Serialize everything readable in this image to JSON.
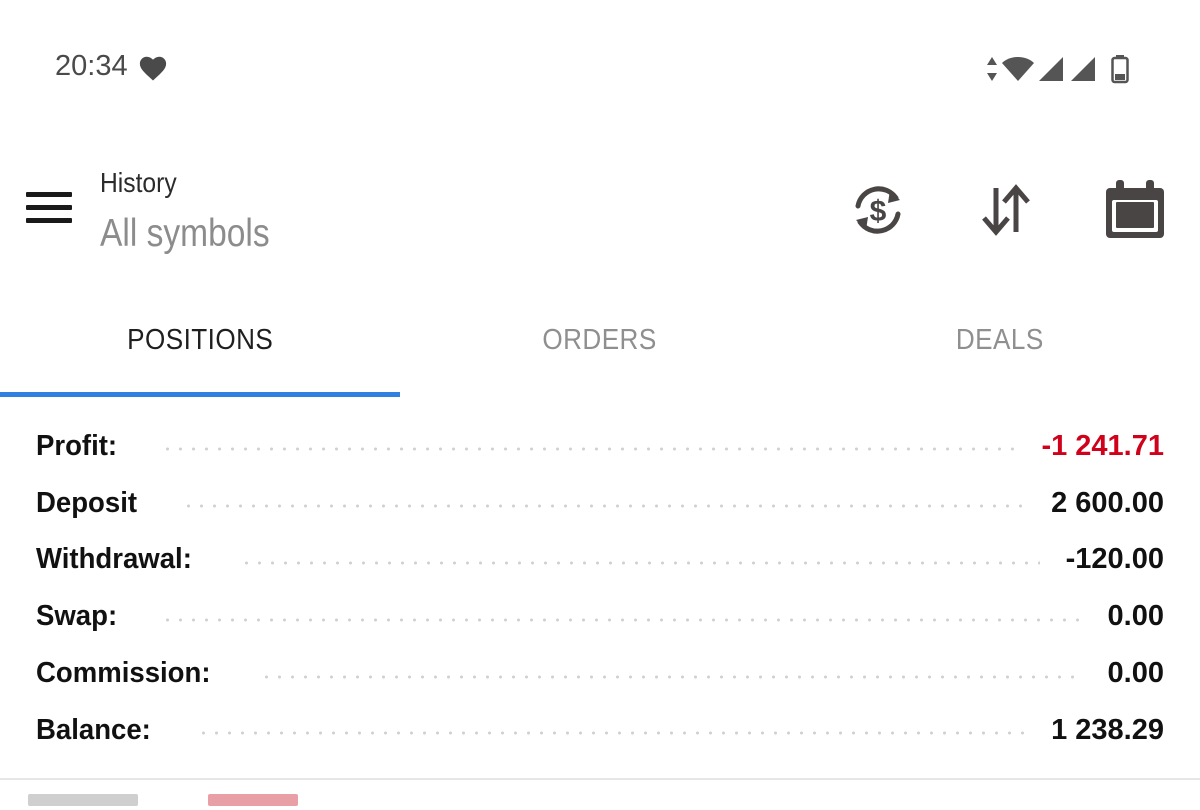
{
  "status_bar": {
    "time": "20:34",
    "icons": [
      "heart-icon",
      "data-arrows-icon",
      "wifi-icon",
      "signal-icon",
      "signal-icon",
      "battery-icon"
    ]
  },
  "toolbar": {
    "title": "History",
    "subtitle": "All symbols",
    "icons": [
      "menu-icon",
      "currency-refresh-icon",
      "sort-icon",
      "calendar-icon"
    ]
  },
  "tabs": [
    {
      "label": "POSITIONS",
      "active": true
    },
    {
      "label": "ORDERS",
      "active": false
    },
    {
      "label": "DEALS",
      "active": false
    }
  ],
  "summary": [
    {
      "label": "Profit:",
      "value": "-1 241.71",
      "negative": true
    },
    {
      "label": "Deposit",
      "value": "2 600.00",
      "negative": false
    },
    {
      "label": "Withdrawal:",
      "value": "-120.00",
      "negative": false
    },
    {
      "label": "Swap:",
      "value": "0.00",
      "negative": false
    },
    {
      "label": "Commission:",
      "value": "0.00",
      "negative": false
    },
    {
      "label": "Balance:",
      "value": "1 238.29",
      "negative": false
    }
  ],
  "colors": {
    "accent": "#2f80e0",
    "negative": "#d0021b",
    "icon": "#4a4545"
  }
}
